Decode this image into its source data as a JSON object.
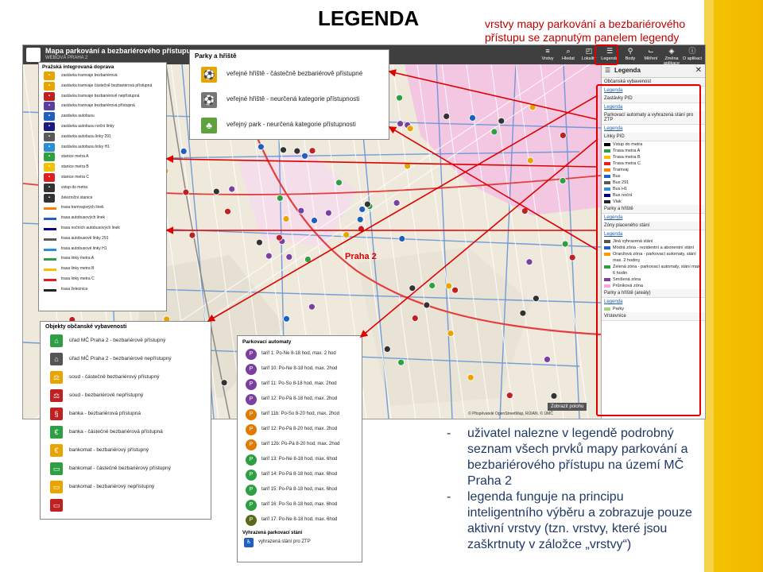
{
  "title": "LEGENDA",
  "subtitle": "vrstvy mapy parkování a bezbariérového přístupu se zapnutým panelem legendy",
  "app": {
    "title": "Mapa parkování a bezbariérového přístupu",
    "subtitle": "WEBOVÁ PRAHA 2",
    "toolbar": [
      {
        "label": "Vrstvy",
        "icon": "layers-icon",
        "glyph": "≡"
      },
      {
        "label": "Hledat",
        "icon": "search-icon",
        "glyph": "⌕"
      },
      {
        "label": "Lokality",
        "icon": "location-icon",
        "glyph": "◰"
      },
      {
        "label": "Legenda",
        "icon": "legend-icon",
        "glyph": "☰"
      },
      {
        "label": "Body",
        "icon": "pin-icon",
        "glyph": "⚲"
      },
      {
        "label": "Měření",
        "icon": "measure-icon",
        "glyph": "⌙"
      },
      {
        "label": "Změna aplikace",
        "icon": "switch-app-icon",
        "glyph": "◈"
      },
      {
        "label": "O aplikaci",
        "icon": "info-icon",
        "glyph": "ⓘ"
      }
    ],
    "map_label": "Praha 2",
    "overview_button": "Zobrazit polohu",
    "attribution": "© Přispěvatelé OpenStreetMap, RÚIAN, © ÚMČ",
    "legend_panel": {
      "heading": "Legenda",
      "sections": [
        {
          "name": "Občanská vybavenost",
          "link": "Legenda"
        },
        {
          "name": "Zastávky PID",
          "link": "Legenda"
        },
        {
          "name": "Parkovací automaty a vyhrazená stání pro ZTP",
          "link": "Legenda"
        },
        {
          "name": "Linky PID",
          "items": [
            {
              "label": "Vstup do metra",
              "color": "#000000"
            },
            {
              "label": "Trasa metra A",
              "color": "#2ea043"
            },
            {
              "label": "Trasa metra B",
              "color": "#f2c200"
            },
            {
              "label": "Trasa metra C",
              "color": "#e02020"
            },
            {
              "label": "Tramvaj",
              "color": "#ff7f00"
            },
            {
              "label": "Bus",
              "color": "#1f5fbf"
            },
            {
              "label": "Bus 291",
              "color": "#5a5a5a"
            },
            {
              "label": "Bus H1",
              "color": "#2c8fd6"
            },
            {
              "label": "Bus noční",
              "color": "#000080"
            },
            {
              "label": "Vlak",
              "color": "#222222"
            }
          ]
        },
        {
          "name": "Parky a hřiště",
          "link": "Legenda"
        },
        {
          "name": "Zóny placeného stání",
          "link": "Legenda",
          "items": [
            {
              "label": "Jiná vyhrazená stání",
              "color": "#555555"
            },
            {
              "label": "Modrá zóna - rezidentní a abonentní stání",
              "color": "#1f5fbf"
            },
            {
              "label": "Oranžová zóna - parkovací automaty, stání max. 2 hodiny",
              "color": "#ff9900"
            },
            {
              "label": "Zelená zóna - parkovací automaty, stání max. 6 hodin",
              "color": "#2ea043"
            },
            {
              "label": "Smíšená zóna",
              "color": "#7b3fa0"
            },
            {
              "label": "Průniková zóna",
              "color": "#f7a6e0"
            }
          ]
        },
        {
          "name": "Parky a hřiště (areály)",
          "link": "Legenda",
          "items": [
            {
              "label": "Parky",
              "color": "#9ed67e"
            }
          ]
        },
        {
          "name": "Vrstevnice"
        }
      ]
    }
  },
  "inset_transport": {
    "title": "Pražská integrovaná doprava",
    "items": [
      {
        "label": "zastávka tramvaje bezbariérová",
        "color": "#e8a400"
      },
      {
        "label": "zastávka tramvaje částečně bezbariérová přístupná",
        "color": "#e8a400"
      },
      {
        "label": "zastávka tramvaje bezbariérově nepřístupná",
        "color": "#c02020"
      },
      {
        "label": "zastávka tramvaje bezbariérová přístupná",
        "color": "#5a3fa0"
      },
      {
        "label": "zastávka autobusu",
        "color": "#1f5fbf"
      },
      {
        "label": "zastávka autobusu noční linky",
        "color": "#1a1a80"
      },
      {
        "label": "zastávka autobusu linky 291",
        "color": "#5a5a5a"
      },
      {
        "label": "zastávka autobusu linky H1",
        "color": "#2c8fd6"
      },
      {
        "label": "stanice metra A",
        "color": "#2ea043"
      },
      {
        "label": "stanice metra B",
        "color": "#f2c200"
      },
      {
        "label": "stanice metra C",
        "color": "#e02020"
      },
      {
        "label": "vstup do metra",
        "color": "#333333"
      },
      {
        "label": "železniční stanice",
        "color": "#333333"
      },
      {
        "label": "trasa tramvajových linek",
        "color": "#ff7f00",
        "line": true
      },
      {
        "label": "trasa autobusových linek",
        "color": "#1f5fbf",
        "line": true
      },
      {
        "label": "trasa nočních autobusových linek",
        "color": "#000080",
        "line": true
      },
      {
        "label": "trasa autobusové linky 291",
        "color": "#5a5a5a",
        "line": true
      },
      {
        "label": "trasa autobusové linky H1",
        "color": "#2c8fd6",
        "line": true
      },
      {
        "label": "trasa linky metra A",
        "color": "#2ea043",
        "line": true
      },
      {
        "label": "trasa linky metra B",
        "color": "#f2c200",
        "line": true
      },
      {
        "label": "trasa linky metra C",
        "color": "#e02020",
        "line": true
      },
      {
        "label": "trasa železnice",
        "color": "#222222",
        "line": true
      }
    ]
  },
  "inset_parks": {
    "title": "Parky a hřiště",
    "items": [
      {
        "label": "veřejné hřiště - částečně bezbariérově přístupné",
        "color": "#e8a400",
        "glyph": "⚽"
      },
      {
        "label": "veřejné hřiště - neurčená kategorie přístupnosti",
        "color": "#777777",
        "glyph": "⚽"
      },
      {
        "label": "veřejný park - neurčená kategorie přístupnosti",
        "color": "#5fa03f",
        "glyph": "♣"
      }
    ]
  },
  "inset_amenities": {
    "title": "Objekty občanské vybavenosti",
    "items": [
      {
        "label": "úřad MČ Praha 2 - bezbariérově přístupný",
        "color": "#2ea043",
        "glyph": "⌂"
      },
      {
        "label": "úřad MČ Praha 2 - bezbariérově nepřístupný",
        "color": "#555555",
        "glyph": "⌂"
      },
      {
        "label": "soud - částečně bezbariérový přístupný",
        "color": "#e8a400",
        "glyph": "⚖"
      },
      {
        "label": "soud - bezbariérově nepřístupný",
        "color": "#c02020",
        "glyph": "⚖"
      },
      {
        "label": "banka - bezbariérová přístupná",
        "color": "#c02020",
        "glyph": "§"
      },
      {
        "label": "banka - částečně bezbariérová přístupná",
        "color": "#2ea043",
        "glyph": "€"
      },
      {
        "label": "bankomat - bezbariérový přístupný",
        "color": "#e8a400",
        "glyph": "€"
      },
      {
        "label": "bankomat - částečně bezbariérový přístupný",
        "color": "#2ea043",
        "glyph": "▭"
      },
      {
        "label": "bankomat - bezbariérový nepřístupný",
        "color": "#e8a400",
        "glyph": "▭"
      },
      {
        "label": "",
        "color": "#c02020",
        "glyph": "▭"
      }
    ]
  },
  "inset_parking": {
    "title": "Parkovací automaty",
    "tariffs": [
      {
        "label": "tarif 1: Po-Ne 8-18 hod, max. 2 hod",
        "color": "#7b3fa0"
      },
      {
        "label": "tarif 10: Po-Ne 8-18 hod, max. 2hod",
        "color": "#7b3fa0"
      },
      {
        "label": "tarif 11: Po-So 8-18 hod, max. 2hod",
        "color": "#7b3fa0"
      },
      {
        "label": "tarif 12: Po-Pá 8-18 hod, max. 2hod",
        "color": "#7b3fa0"
      },
      {
        "label": "tarif 11b: Po-So 8-20 hod, max. 2hod",
        "color": "#e07a00"
      },
      {
        "label": "tarif 12: Po-Pá 8-20 hod, max. 2hod",
        "color": "#e07a00"
      },
      {
        "label": "tarif 12b: Po-Pá 8-20 hod, max. 2hod",
        "color": "#e07a00"
      },
      {
        "label": "tarif 13: Po-Ne 8-18 hod, max. 6hod",
        "color": "#2ea043"
      },
      {
        "label": "tarif 14: Po-Pá 8-18 hod, max. 6hod",
        "color": "#2ea043"
      },
      {
        "label": "tarif 15: Po-Pá 8-18 hod, max. 6hod",
        "color": "#2ea043"
      },
      {
        "label": "tarif 16: Po-So 8-18 hod, max. 6hod",
        "color": "#2ea043"
      },
      {
        "label": "tarif 17: Po-Ne 8-18 hod, max. 6hod",
        "color": "#5a6a1a"
      }
    ],
    "reserved_title": "Vyhrazená parkovací stání",
    "reserved_item": "vyhrazená stání pro ZTP"
  },
  "notes": [
    {
      "dash": "-",
      "text": "uživatel nalezne v legendě podrobný seznam všech prvků mapy parkování a bezbariérového přístupu na území MČ Praha 2"
    },
    {
      "dash": "-",
      "text": "legenda funguje na principu inteligentního výběru a zobrazuje pouze aktivní vrstvy (tzn. vrstvy, které jsou zaškrtnuty v záložce „vrstvy“)"
    }
  ],
  "colors": {
    "accent_red": "#e00000",
    "band": "#f5c400",
    "text_blue": "#1f3864"
  }
}
